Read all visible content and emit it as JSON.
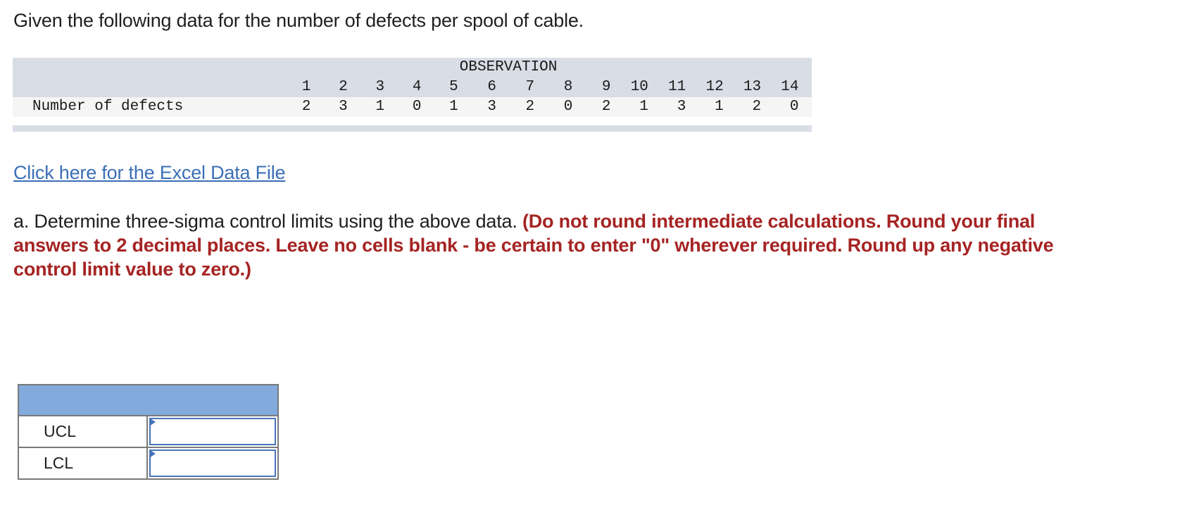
{
  "intro_text": "Given the following data for the number of defects per spool of cable.",
  "data_table": {
    "group_header": "OBSERVATION",
    "row_label": "Number of defects",
    "observations": [
      "1",
      "2",
      "3",
      "4",
      "5",
      "6",
      "7",
      "8",
      "9",
      "10",
      "11",
      "12",
      "13",
      "14"
    ],
    "defects": [
      "2",
      "3",
      "1",
      "0",
      "1",
      "3",
      "2",
      "0",
      "2",
      "1",
      "3",
      "1",
      "2",
      "0"
    ]
  },
  "excel_link_label": "Click here for the Excel Data File",
  "question": {
    "prefix": "a. Determine three-sigma control limits using the above data.",
    "instructions": "(Do not round intermediate calculations. Round your final answers to 2 decimal places. Leave no cells blank - be certain to enter \"0\" wherever required. Round up any negative control limit value to zero.)"
  },
  "answer_table": {
    "rows": [
      {
        "label": "UCL",
        "value": ""
      },
      {
        "label": "LCL",
        "value": ""
      }
    ]
  },
  "colors": {
    "link": "#3c6fb6",
    "instruction_red": "#a52423",
    "table_header_blue": "#82aadd",
    "input_border": "#4874b7",
    "data_table_band": "#d9dde6"
  }
}
